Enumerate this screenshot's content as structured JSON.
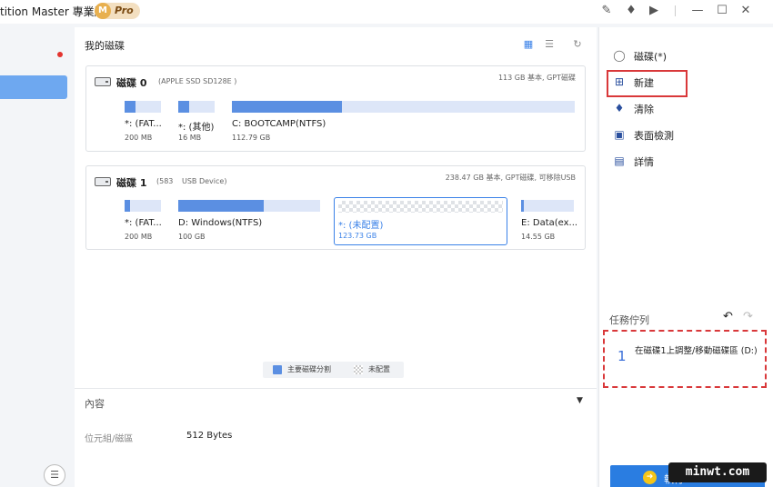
{
  "titlebar": {
    "app_title": "tition Master 專業版",
    "pro_badge_letter": "M",
    "pro_badge_text": "Pro"
  },
  "main": {
    "title": "我的磁碟",
    "disks": [
      {
        "name": "磁碟 0",
        "model": "(APPLE SSD SD128E )",
        "info": "113 GB 基本, GPT磁碟",
        "partitions": [
          {
            "name": "*: (FAT...",
            "size": "200 MB",
            "used_fraction": 0.3
          },
          {
            "name": "*: (其他)",
            "size": "16 MB",
            "used_fraction": 0.3
          },
          {
            "name": "C: BOOTCAMP(NTFS)",
            "size": "112.79 GB",
            "used_fraction": 0.32
          }
        ]
      },
      {
        "name": "磁碟 1",
        "model": "(583",
        "model_extra": "USB Device)",
        "info": "238.47 GB 基本, GPT磁碟, 可移除USB",
        "partitions": [
          {
            "name": "*: (FAT...",
            "size": "200 MB",
            "used_fraction": 0.15
          },
          {
            "name": "D: Windows(NTFS)",
            "size": "100 GB",
            "used_fraction": 0.6
          },
          {
            "name": "*: (未配置)",
            "size": "123.73 GB",
            "unallocated": true
          },
          {
            "name": "E: Data(ex...",
            "size": "14.55 GB",
            "used_fraction": 0.05
          }
        ]
      }
    ],
    "legend": {
      "primary": "主要磁碟分割",
      "unallocated": "未配置"
    },
    "content_label": "內容",
    "content_toggle": "▼",
    "properties": [
      {
        "label": "位元組/磁區",
        "value": "512 Bytes"
      }
    ]
  },
  "right": {
    "actions": [
      {
        "label": "磁碟(*)",
        "icon": "disk-icon"
      },
      {
        "label": "新建",
        "icon": "new-partition-icon"
      },
      {
        "label": "清除",
        "icon": "eraser-icon"
      },
      {
        "label": "表面檢測",
        "icon": "surface-test-icon"
      },
      {
        "label": "詳情",
        "icon": "details-icon"
      }
    ],
    "queue": {
      "title": "任務佇列",
      "items": [
        {
          "num": "1",
          "text": "在磁碟1上調整/移動磁碟區 (D:)"
        }
      ]
    },
    "execute_label": "執行"
  },
  "watermark": "minwt.com"
}
